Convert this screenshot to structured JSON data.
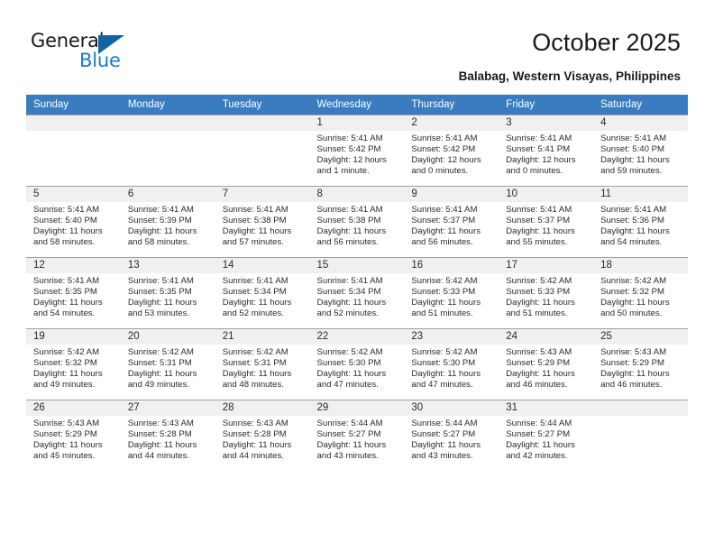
{
  "brand": {
    "name_top": "General",
    "name_bottom": "Blue",
    "triangle_color": "#1464a5",
    "blue_text_color": "#1b79c4"
  },
  "header": {
    "title": "October 2025",
    "subtitle": "Balabag, Western Visayas, Philippines",
    "header_bg": "#3a7cc0",
    "header_text": "#ffffff"
  },
  "weekdays": [
    "Sunday",
    "Monday",
    "Tuesday",
    "Wednesday",
    "Thursday",
    "Friday",
    "Saturday"
  ],
  "weeks": [
    [
      {
        "day": "",
        "blank": true
      },
      {
        "day": "",
        "blank": true
      },
      {
        "day": "",
        "blank": true
      },
      {
        "day": "1",
        "sunrise": "Sunrise: 5:41 AM",
        "sunset": "Sunset: 5:42 PM",
        "daylight": "Daylight: 12 hours and 1 minute."
      },
      {
        "day": "2",
        "sunrise": "Sunrise: 5:41 AM",
        "sunset": "Sunset: 5:42 PM",
        "daylight": "Daylight: 12 hours and 0 minutes."
      },
      {
        "day": "3",
        "sunrise": "Sunrise: 5:41 AM",
        "sunset": "Sunset: 5:41 PM",
        "daylight": "Daylight: 12 hours and 0 minutes."
      },
      {
        "day": "4",
        "sunrise": "Sunrise: 5:41 AM",
        "sunset": "Sunset: 5:40 PM",
        "daylight": "Daylight: 11 hours and 59 minutes."
      }
    ],
    [
      {
        "day": "5",
        "sunrise": "Sunrise: 5:41 AM",
        "sunset": "Sunset: 5:40 PM",
        "daylight": "Daylight: 11 hours and 58 minutes."
      },
      {
        "day": "6",
        "sunrise": "Sunrise: 5:41 AM",
        "sunset": "Sunset: 5:39 PM",
        "daylight": "Daylight: 11 hours and 58 minutes."
      },
      {
        "day": "7",
        "sunrise": "Sunrise: 5:41 AM",
        "sunset": "Sunset: 5:38 PM",
        "daylight": "Daylight: 11 hours and 57 minutes."
      },
      {
        "day": "8",
        "sunrise": "Sunrise: 5:41 AM",
        "sunset": "Sunset: 5:38 PM",
        "daylight": "Daylight: 11 hours and 56 minutes."
      },
      {
        "day": "9",
        "sunrise": "Sunrise: 5:41 AM",
        "sunset": "Sunset: 5:37 PM",
        "daylight": "Daylight: 11 hours and 56 minutes."
      },
      {
        "day": "10",
        "sunrise": "Sunrise: 5:41 AM",
        "sunset": "Sunset: 5:37 PM",
        "daylight": "Daylight: 11 hours and 55 minutes."
      },
      {
        "day": "11",
        "sunrise": "Sunrise: 5:41 AM",
        "sunset": "Sunset: 5:36 PM",
        "daylight": "Daylight: 11 hours and 54 minutes."
      }
    ],
    [
      {
        "day": "12",
        "sunrise": "Sunrise: 5:41 AM",
        "sunset": "Sunset: 5:35 PM",
        "daylight": "Daylight: 11 hours and 54 minutes."
      },
      {
        "day": "13",
        "sunrise": "Sunrise: 5:41 AM",
        "sunset": "Sunset: 5:35 PM",
        "daylight": "Daylight: 11 hours and 53 minutes."
      },
      {
        "day": "14",
        "sunrise": "Sunrise: 5:41 AM",
        "sunset": "Sunset: 5:34 PM",
        "daylight": "Daylight: 11 hours and 52 minutes."
      },
      {
        "day": "15",
        "sunrise": "Sunrise: 5:41 AM",
        "sunset": "Sunset: 5:34 PM",
        "daylight": "Daylight: 11 hours and 52 minutes."
      },
      {
        "day": "16",
        "sunrise": "Sunrise: 5:42 AM",
        "sunset": "Sunset: 5:33 PM",
        "daylight": "Daylight: 11 hours and 51 minutes."
      },
      {
        "day": "17",
        "sunrise": "Sunrise: 5:42 AM",
        "sunset": "Sunset: 5:33 PM",
        "daylight": "Daylight: 11 hours and 51 minutes."
      },
      {
        "day": "18",
        "sunrise": "Sunrise: 5:42 AM",
        "sunset": "Sunset: 5:32 PM",
        "daylight": "Daylight: 11 hours and 50 minutes."
      }
    ],
    [
      {
        "day": "19",
        "sunrise": "Sunrise: 5:42 AM",
        "sunset": "Sunset: 5:32 PM",
        "daylight": "Daylight: 11 hours and 49 minutes."
      },
      {
        "day": "20",
        "sunrise": "Sunrise: 5:42 AM",
        "sunset": "Sunset: 5:31 PM",
        "daylight": "Daylight: 11 hours and 49 minutes."
      },
      {
        "day": "21",
        "sunrise": "Sunrise: 5:42 AM",
        "sunset": "Sunset: 5:31 PM",
        "daylight": "Daylight: 11 hours and 48 minutes."
      },
      {
        "day": "22",
        "sunrise": "Sunrise: 5:42 AM",
        "sunset": "Sunset: 5:30 PM",
        "daylight": "Daylight: 11 hours and 47 minutes."
      },
      {
        "day": "23",
        "sunrise": "Sunrise: 5:42 AM",
        "sunset": "Sunset: 5:30 PM",
        "daylight": "Daylight: 11 hours and 47 minutes."
      },
      {
        "day": "24",
        "sunrise": "Sunrise: 5:43 AM",
        "sunset": "Sunset: 5:29 PM",
        "daylight": "Daylight: 11 hours and 46 minutes."
      },
      {
        "day": "25",
        "sunrise": "Sunrise: 5:43 AM",
        "sunset": "Sunset: 5:29 PM",
        "daylight": "Daylight: 11 hours and 46 minutes."
      }
    ],
    [
      {
        "day": "26",
        "sunrise": "Sunrise: 5:43 AM",
        "sunset": "Sunset: 5:29 PM",
        "daylight": "Daylight: 11 hours and 45 minutes."
      },
      {
        "day": "27",
        "sunrise": "Sunrise: 5:43 AM",
        "sunset": "Sunset: 5:28 PM",
        "daylight": "Daylight: 11 hours and 44 minutes."
      },
      {
        "day": "28",
        "sunrise": "Sunrise: 5:43 AM",
        "sunset": "Sunset: 5:28 PM",
        "daylight": "Daylight: 11 hours and 44 minutes."
      },
      {
        "day": "29",
        "sunrise": "Sunrise: 5:44 AM",
        "sunset": "Sunset: 5:27 PM",
        "daylight": "Daylight: 11 hours and 43 minutes."
      },
      {
        "day": "30",
        "sunrise": "Sunrise: 5:44 AM",
        "sunset": "Sunset: 5:27 PM",
        "daylight": "Daylight: 11 hours and 43 minutes."
      },
      {
        "day": "31",
        "sunrise": "Sunrise: 5:44 AM",
        "sunset": "Sunset: 5:27 PM",
        "daylight": "Daylight: 11 hours and 42 minutes."
      },
      {
        "day": "",
        "blank": true
      }
    ]
  ]
}
